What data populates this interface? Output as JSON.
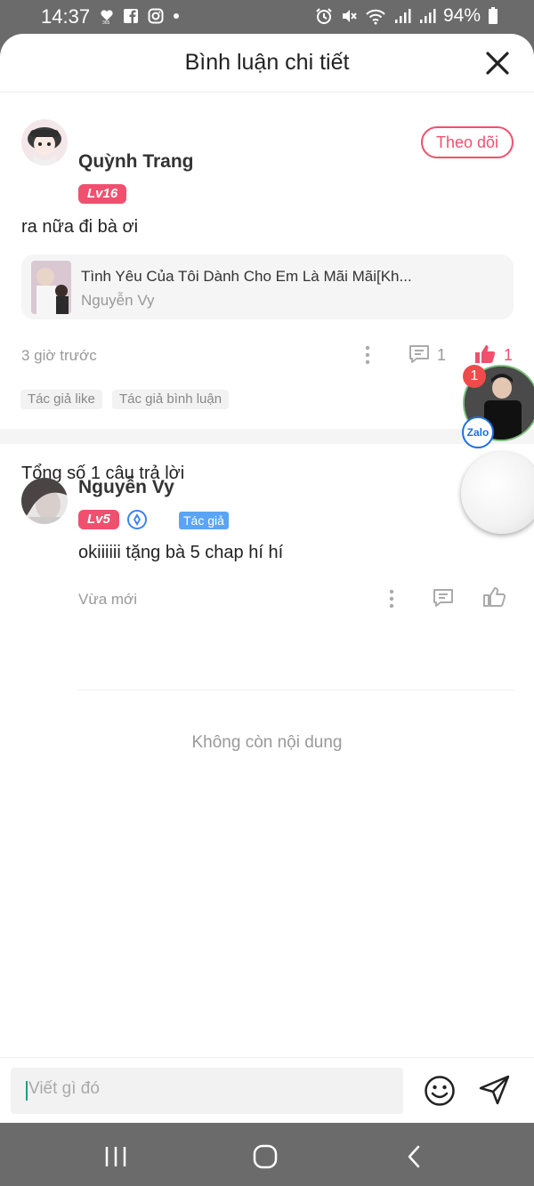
{
  "status_bar": {
    "time": "14:37",
    "battery": "94%",
    "left_icons": [
      "heart-365-icon",
      "facebook-icon",
      "instagram-icon",
      "dot-icon"
    ],
    "right_icons": [
      "alarm-icon",
      "mute-icon",
      "wifi-icon",
      "signal-icon",
      "signal-icon",
      "battery-icon"
    ]
  },
  "header": {
    "title": "Bình luận chi tiết"
  },
  "comment": {
    "username": "Quỳnh Trang",
    "level": "Lv16",
    "follow_label": "Theo dõi",
    "text": "ra nữa đi bà ơi",
    "book": {
      "title": "Tình Yêu Của Tôi Dành Cho Em Là Mãi Mãi[Kh...",
      "author": "Nguyễn Vy"
    },
    "time": "3 giờ trước",
    "reply_count": "1",
    "like_count": "1",
    "tags": [
      "Tác giả like",
      "Tác giả bình luận"
    ]
  },
  "replies_section": {
    "total_label": "Tổng số 1 câu trả lời",
    "replies": [
      {
        "username": "Nguyễn Vy",
        "author_tag": "Tác giả",
        "level": "Lv5",
        "text": "okiiiiii tặng bà 5 chap hí hí",
        "time": "Vừa mới"
      }
    ],
    "end_label": "Không còn nội dung"
  },
  "floating": {
    "zalo_badge": "1",
    "zalo_label": "Zalo"
  },
  "input": {
    "placeholder": "Viết gì đó"
  },
  "colors": {
    "accent": "#f0506e",
    "author_tag": "#5aa4f5",
    "muted": "#999999"
  }
}
